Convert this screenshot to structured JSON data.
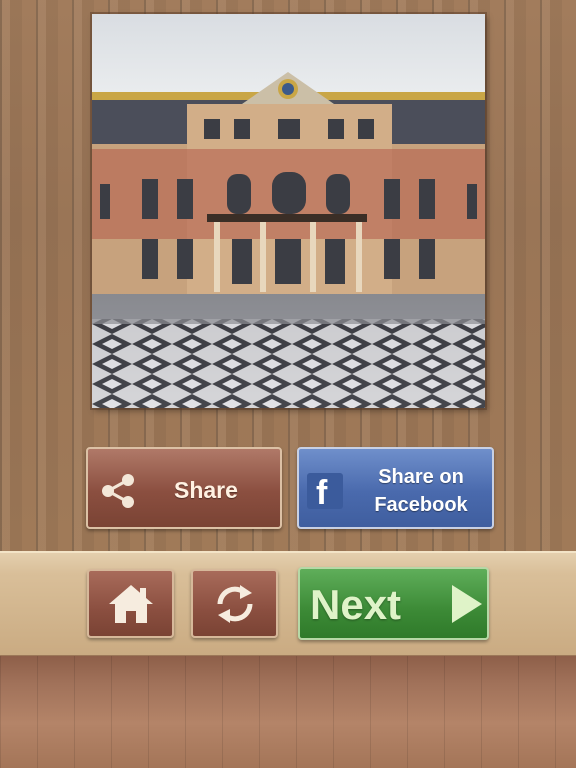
{
  "puzzle": {
    "image_icon": "palace-courtyard-photo"
  },
  "buttons": {
    "share_label": "Share",
    "facebook_line1": "Share on",
    "facebook_line2": "Facebook",
    "next_label": "Next"
  },
  "icons": {
    "share": "share-icon",
    "facebook": "facebook-icon",
    "home": "home-icon",
    "restart": "restart-icon",
    "play": "play-icon"
  },
  "colors": {
    "share_button": "#8b4f40",
    "facebook_button": "#4a6aad",
    "next_button": "#3c8a36",
    "wood": "#9a7556"
  }
}
